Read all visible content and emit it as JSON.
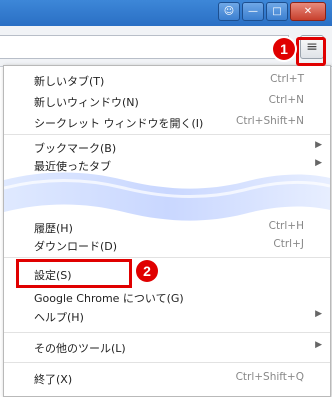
{
  "menu": {
    "items": [
      {
        "label": "新しいタブ(T)",
        "shortcut": "Ctrl+T"
      },
      {
        "label": "新しいウィンドウ(N)",
        "shortcut": "Ctrl+N"
      },
      {
        "label": "シークレット ウィンドウを開く(I)",
        "shortcut": "Ctrl+Shift+N"
      },
      {
        "label": "ブックマーク(B)"
      },
      {
        "label": "最近使ったタブ"
      },
      {
        "label": "履歴(H)",
        "shortcut": "Ctrl+H"
      },
      {
        "label": "ダウンロード(D)",
        "shortcut": "Ctrl+J"
      },
      {
        "label": "設定(S)"
      },
      {
        "label": "Google Chrome について(G)"
      },
      {
        "label": "ヘルプ(H)"
      },
      {
        "label": "その他のツール(L)"
      },
      {
        "label": "終了(X)",
        "shortcut": "Ctrl+Shift+Q"
      }
    ]
  },
  "annotations": {
    "badge1": "1",
    "badge2": "2"
  },
  "icons": {
    "menu": "hamburger-icon",
    "submenu": "chevron-right-icon"
  },
  "colors": {
    "highlight": "#e00000",
    "titlebar": "#2a6fc4"
  }
}
